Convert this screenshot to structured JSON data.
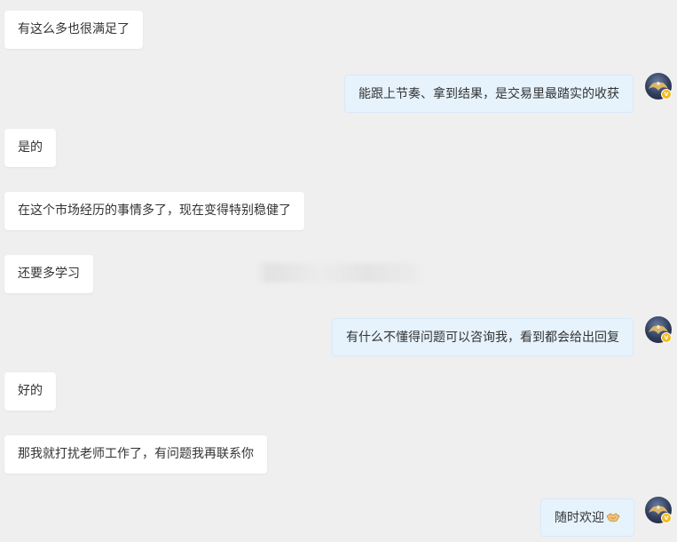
{
  "messages": [
    {
      "side": "in",
      "text": "有这么多也很满足了"
    },
    {
      "side": "out",
      "text": "能跟上节奏、拿到结果，是交易里最踏实的收获"
    },
    {
      "side": "in",
      "text": "是的"
    },
    {
      "side": "in",
      "text": "在这个市场经历的事情多了，现在变得特别稳健了"
    },
    {
      "side": "in",
      "text": "还要多学习"
    },
    {
      "side": "out",
      "text": "有什么不懂得问题可以咨询我，看到都会给出回复"
    },
    {
      "side": "in",
      "text": "好的"
    },
    {
      "side": "in",
      "text": "那我就打扰老师工作了，有问题我再联系你"
    },
    {
      "side": "out",
      "text": "随时欢迎",
      "emoji": "handshake-emoji"
    }
  ],
  "avatar": {
    "badge": "v",
    "icon": "eagle-avatar-icon"
  },
  "colors": {
    "background": "#efefef",
    "incoming_bubble": "#ffffff",
    "outgoing_bubble": "#e6f3fd",
    "badge": "#f5b91f"
  }
}
